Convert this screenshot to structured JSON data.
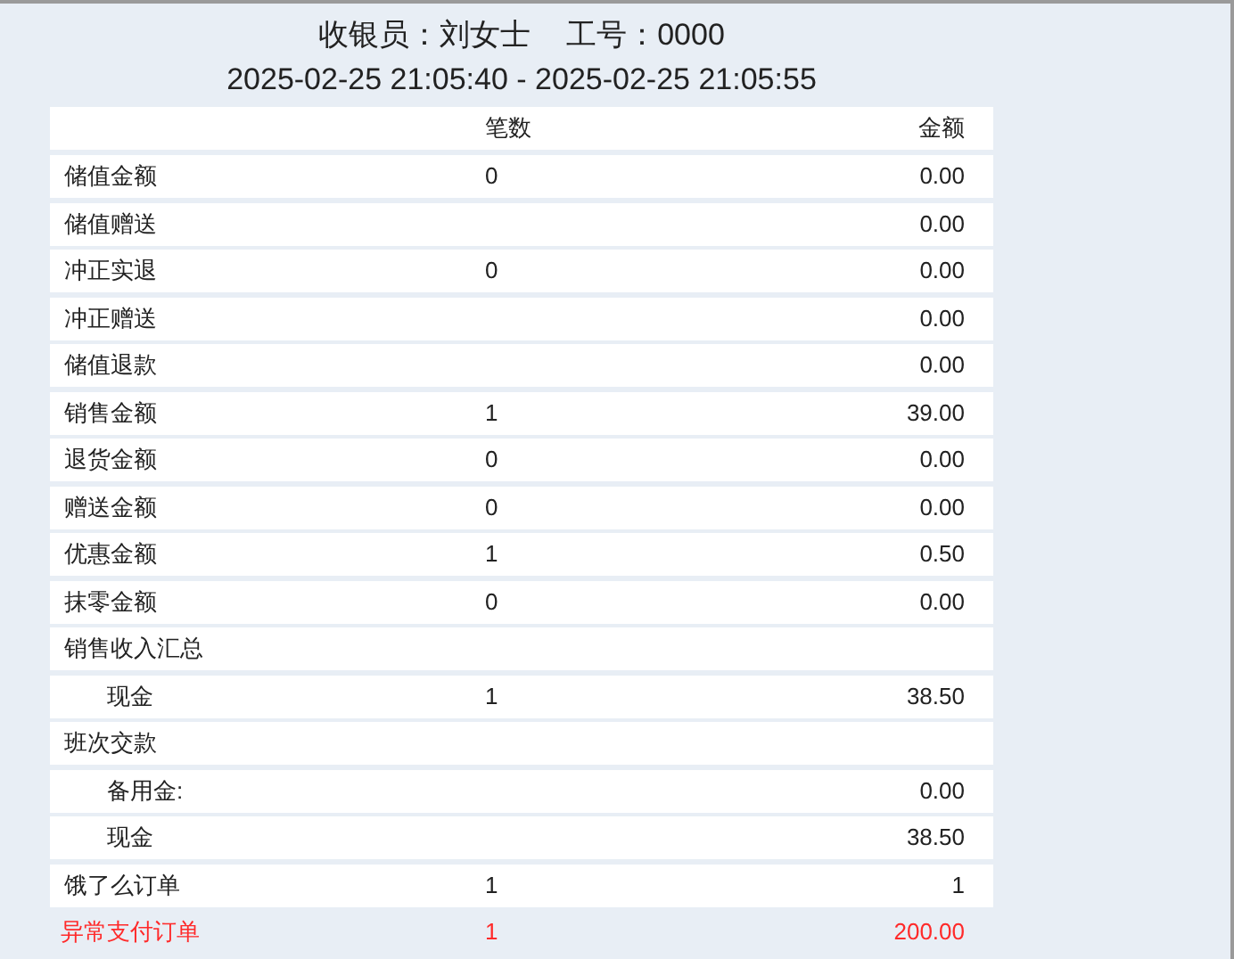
{
  "header": {
    "cashier": "收银员：刘女士",
    "staff_no": "工号：0000",
    "period": "2025-02-25 21:05:40 - 2025-02-25 21:05:55"
  },
  "table": {
    "columns": [
      "笔数",
      "金额"
    ],
    "rows": [
      {
        "kind": "normal",
        "name": "储值金额",
        "count": "0",
        "amount": "0.00"
      },
      {
        "kind": "normal",
        "name": "储值赠送",
        "amount": "0.00"
      },
      {
        "kind": "normal",
        "name": "冲正实退",
        "count": "0",
        "amount": "0.00"
      },
      {
        "kind": "normal",
        "name": "冲正赠送",
        "amount": "0.00"
      },
      {
        "kind": "normal",
        "name": "储值退款",
        "amount": "0.00"
      },
      {
        "kind": "normal",
        "name": "销售金额",
        "count": "1",
        "amount": "39.00"
      },
      {
        "kind": "normal",
        "name": "退货金额",
        "count": "0",
        "amount": "0.00"
      },
      {
        "kind": "normal",
        "name": "赠送金额",
        "count": "0",
        "amount": "0.00"
      },
      {
        "kind": "normal",
        "name": "优惠金额",
        "count": "1",
        "amount": "0.50"
      },
      {
        "kind": "normal",
        "name": "抹零金额",
        "count": "0",
        "amount": "0.00"
      },
      {
        "kind": "normal",
        "name": "销售收入汇总",
        "children": [
          {
            "name": "现金",
            "count": "1",
            "amount": "38.50"
          }
        ]
      },
      {
        "kind": "normal",
        "name": "班次交款",
        "children": [
          {
            "name": "备用金:",
            "amount": "0.00"
          },
          {
            "name": "现金",
            "amount": "38.50"
          }
        ]
      },
      {
        "kind": "normal",
        "name": "饿了么订单",
        "count": "1",
        "amount": "1"
      },
      {
        "kind": "alert",
        "name": "异常支付订单",
        "count": "1",
        "amount": "200.00"
      }
    ]
  }
}
